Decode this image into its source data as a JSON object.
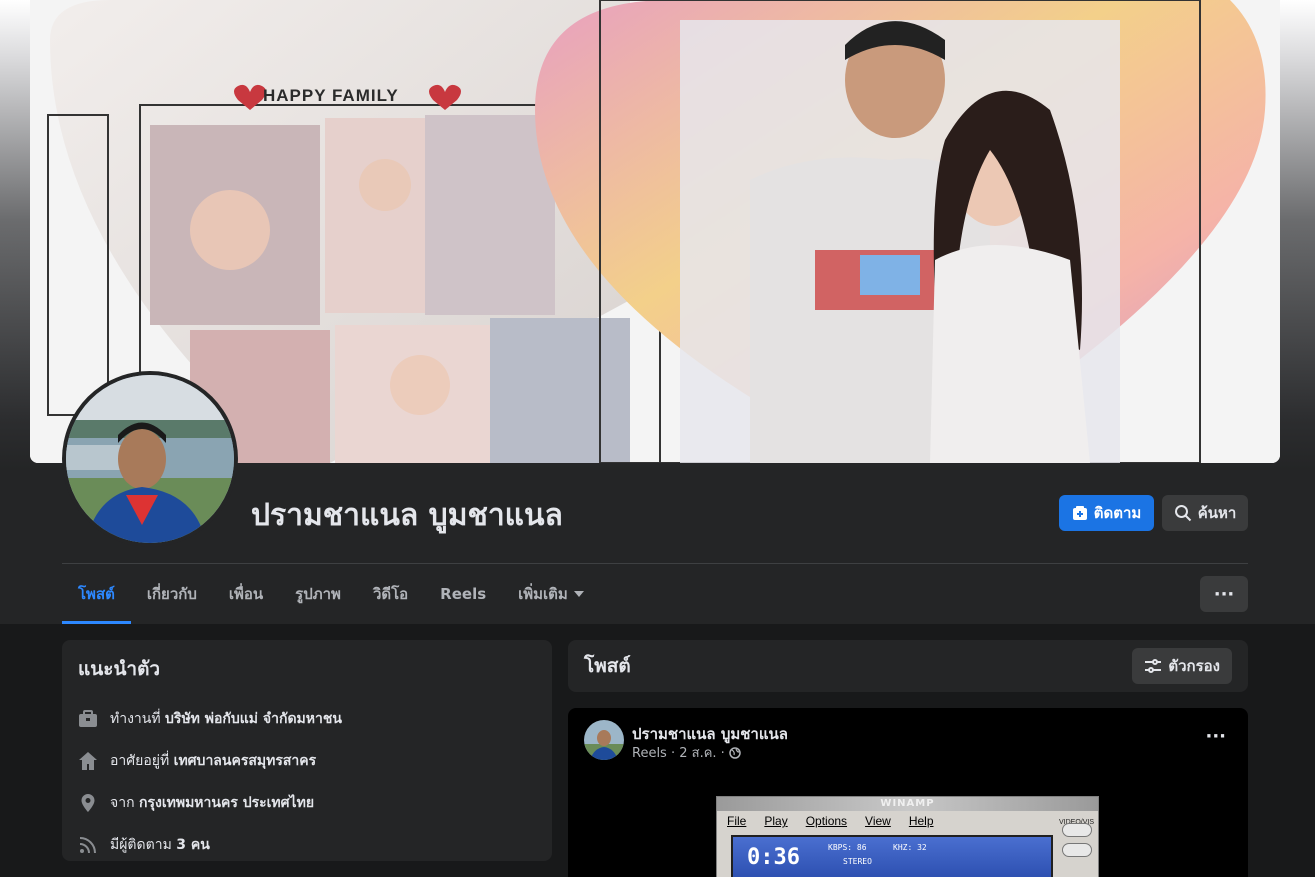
{
  "cover": {
    "banner_text": "HAPPY FAMILY"
  },
  "profile": {
    "name": "ปรามชาแนล บูมชาแนล"
  },
  "actions": {
    "follow_label": "ติดตาม",
    "search_label": "ค้นหา"
  },
  "tabs": [
    {
      "label": "โพสต์",
      "active": true
    },
    {
      "label": "เกี่ยวกับ",
      "active": false
    },
    {
      "label": "เพื่อน",
      "active": false
    },
    {
      "label": "รูปภาพ",
      "active": false
    },
    {
      "label": "วิดีโอ",
      "active": false
    },
    {
      "label": "Reels",
      "active": false
    },
    {
      "label": "เพิ่มเติม",
      "active": false
    }
  ],
  "more_label": "···",
  "intro": {
    "title": "แนะนำตัว",
    "items": [
      {
        "icon": "briefcase-icon",
        "prefix": "ทำงานที่ ",
        "value": "บริษัท พ่อกับแม่ จำกัดมหาชน"
      },
      {
        "icon": "home-icon",
        "prefix": "อาศัยอยู่ที่ ",
        "value": "เทศบาลนครสมุทรสาคร"
      },
      {
        "icon": "location-pin-icon",
        "prefix": "จาก ",
        "value": "กรุงเทพมหานคร ประเทศไทย"
      },
      {
        "icon": "rss-icon",
        "prefix": "มีผู้ติดตาม ",
        "value": "3 คน"
      }
    ]
  },
  "posts": {
    "title": "โพสต์",
    "filter_label": "ตัวกรอง"
  },
  "post": {
    "author": "ปรามชาแนล บูมชาแนล",
    "meta": "Reels · 2 ส.ค. ·",
    "dots": "···"
  },
  "winamp": {
    "title": "WINAMP",
    "menu": [
      "File",
      "Play",
      "Options",
      "View",
      "Help"
    ],
    "time": "0:36",
    "kbps": "KBPS: 86",
    "khz": "KHZ: 32",
    "stereo": "STEREO",
    "side_label": "VIDEO/VIS"
  },
  "colors": {
    "accent": "#1b74e4",
    "tab_active": "#2d88ff",
    "card_bg": "#242526",
    "page_bg": "#18191a"
  }
}
